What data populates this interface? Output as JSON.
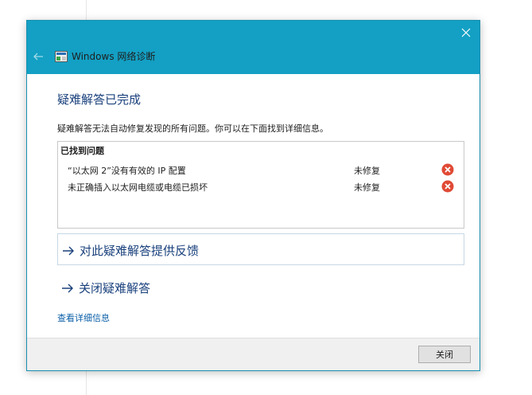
{
  "window": {
    "title": "Windows 网络诊断"
  },
  "main": {
    "heading": "疑难解答已完成",
    "description": "疑难解答无法自动修复发现的所有问题。你可以在下面找到详细信息。",
    "problems": {
      "header": "已找到问题",
      "items": [
        {
          "text": "“以太网 2”没有有效的 IP 配置",
          "status": "未修复",
          "status_icon": "error-icon"
        },
        {
          "text": "未正确插入以太网电缆或电缆已损坏",
          "status": "未修复",
          "status_icon": "error-icon"
        }
      ]
    },
    "links": {
      "feedback": "对此疑难解答提供反馈",
      "close_troubleshooter": "关闭疑难解答",
      "details": "查看详细信息"
    }
  },
  "footer": {
    "close_label": "关闭"
  },
  "colors": {
    "titlebar": "#13a0c4",
    "link": "#19407c",
    "error": "#e04a35"
  }
}
